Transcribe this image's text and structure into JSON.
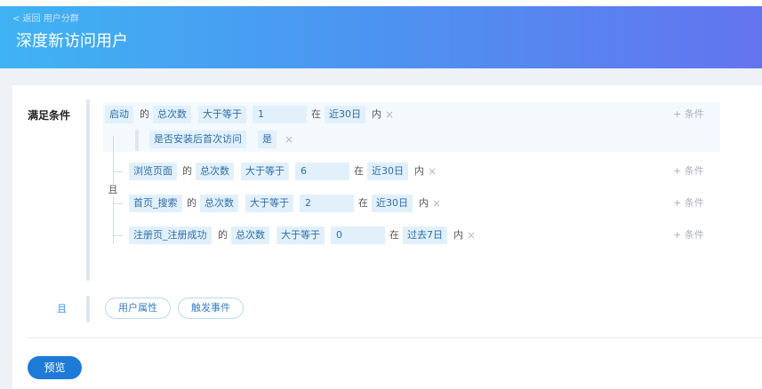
{
  "header": {
    "back_label": "< 返回 用户分群",
    "title": "深度新访问用户"
  },
  "conditions": {
    "section_label": "满足条件",
    "and_inner": "且",
    "and_outer": "且",
    "add_condition_label": "+ 条件",
    "rows": [
      {
        "event": "启动",
        "of": "的",
        "metric": "总次数",
        "op": "大于等于",
        "value": "1",
        "in": "在",
        "range": "近30日",
        "within": "内"
      },
      {
        "event": "浏览页面",
        "of": "的",
        "metric": "总次数",
        "op": "大于等于",
        "value": "6",
        "in": "在",
        "range": "近30日",
        "within": "内"
      },
      {
        "event": "首页_搜索",
        "of": "的",
        "metric": "总次数",
        "op": "大于等于",
        "value": "2",
        "in": "在",
        "range": "近30日",
        "within": "内"
      },
      {
        "event": "注册页_注册成功",
        "of": "的",
        "metric": "总次数",
        "op": "大于等于",
        "value": "0",
        "in": "在",
        "range": "过去7日",
        "within": "内"
      }
    ],
    "sub_condition": {
      "property": "是否安装后首次访问",
      "value": "是"
    }
  },
  "add_buttons": {
    "user_attr": "用户属性",
    "trigger_event": "触发事件"
  },
  "preview_label": "预览",
  "colors": {
    "accent": "#1d7ad7",
    "chip_bg": "#e1f0fb",
    "gradient_start": "#3fb3f3",
    "gradient_end": "#6374ef"
  }
}
